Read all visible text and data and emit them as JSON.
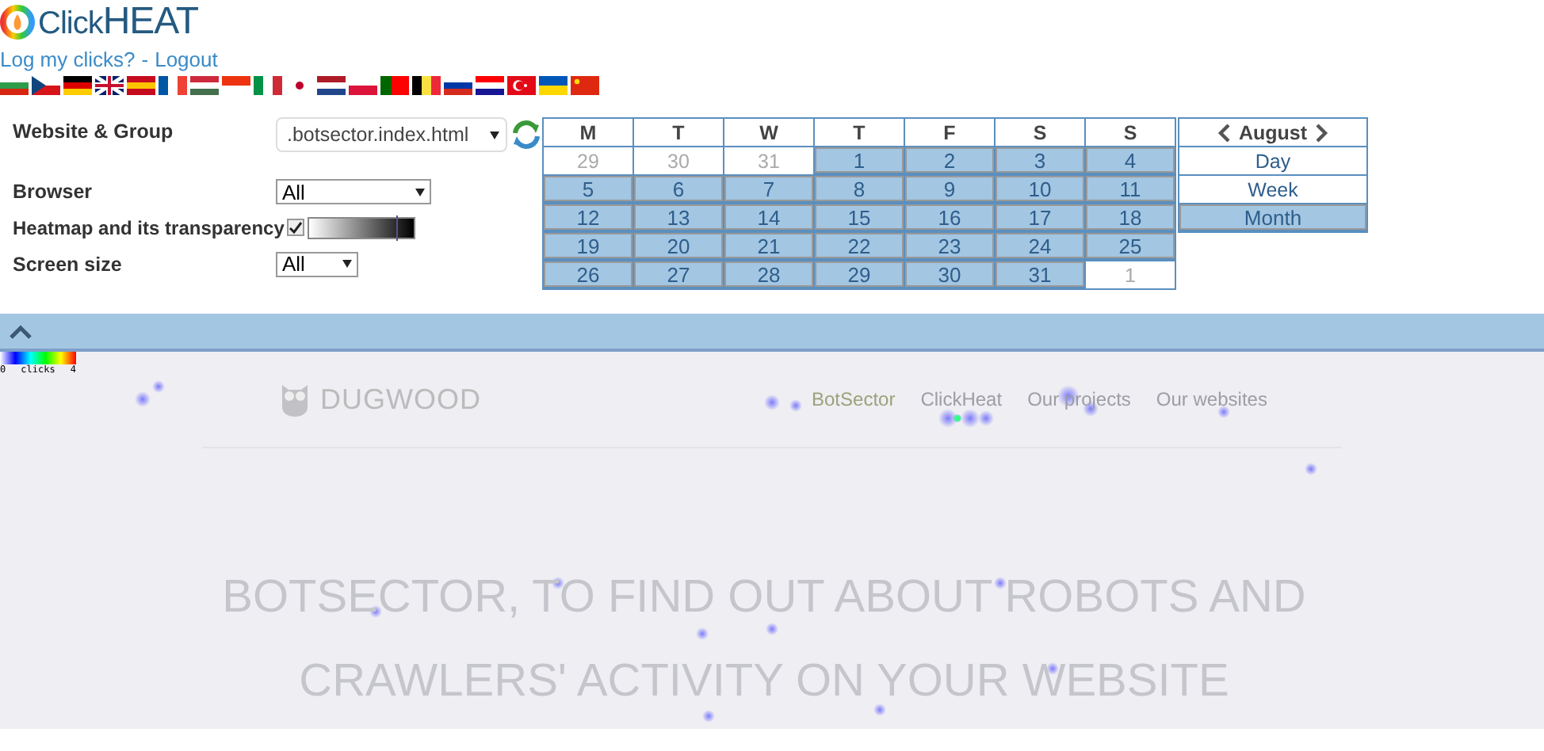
{
  "header": {
    "logo_light": "Click",
    "logo_bold": "HEAT",
    "links": [
      "Log my clicks?",
      "Logout"
    ],
    "separator": "-"
  },
  "form": [
    {
      "kind": "select-refresh",
      "label": "Website & Group",
      "value": ".botsector.index.html"
    },
    {
      "kind": "select",
      "label": "Browser",
      "value": "All"
    },
    {
      "kind": "transparency",
      "label": "Heatmap and its transparency",
      "checked": true,
      "level": 0.82
    },
    {
      "kind": "select-small",
      "label": "Screen size",
      "value": "All"
    }
  ],
  "calendar": {
    "weekdays": [
      "M",
      "T",
      "W",
      "T",
      "F",
      "S",
      "S"
    ],
    "weeks": [
      [
        {
          "day": "29",
          "selected": false
        },
        {
          "day": "30",
          "selected": false
        },
        {
          "day": "31",
          "selected": false
        },
        {
          "day": "1",
          "selected": true
        },
        {
          "day": "2",
          "selected": true
        },
        {
          "day": "3",
          "selected": true
        },
        {
          "day": "4",
          "selected": true
        }
      ],
      [
        {
          "day": "5",
          "selected": true
        },
        {
          "day": "6",
          "selected": true
        },
        {
          "day": "7",
          "selected": true
        },
        {
          "day": "8",
          "selected": true
        },
        {
          "day": "9",
          "selected": true
        },
        {
          "day": "10",
          "selected": true
        },
        {
          "day": "11",
          "selected": true
        }
      ],
      [
        {
          "day": "12",
          "selected": true
        },
        {
          "day": "13",
          "selected": true
        },
        {
          "day": "14",
          "selected": true
        },
        {
          "day": "15",
          "selected": true
        },
        {
          "day": "16",
          "selected": true
        },
        {
          "day": "17",
          "selected": true
        },
        {
          "day": "18",
          "selected": true
        }
      ],
      [
        {
          "day": "19",
          "selected": true
        },
        {
          "day": "20",
          "selected": true
        },
        {
          "day": "21",
          "selected": true
        },
        {
          "day": "22",
          "selected": true
        },
        {
          "day": "23",
          "selected": true
        },
        {
          "day": "24",
          "selected": true
        },
        {
          "day": "25",
          "selected": true
        }
      ],
      [
        {
          "day": "26",
          "selected": true
        },
        {
          "day": "27",
          "selected": true
        },
        {
          "day": "28",
          "selected": true
        },
        {
          "day": "29",
          "selected": true
        },
        {
          "day": "30",
          "selected": true
        },
        {
          "day": "31",
          "selected": true
        },
        {
          "day": "1",
          "selected": false
        }
      ]
    ],
    "month": "August",
    "views": [
      {
        "label": "Day",
        "selected": false
      },
      {
        "label": "Week",
        "selected": false
      },
      {
        "label": "Month",
        "selected": true
      }
    ]
  },
  "preview": {
    "legend": {
      "min": "0",
      "label": "clicks",
      "max": "4"
    },
    "site_logo": "DUGWOOD",
    "nav": [
      {
        "label": "BotSector",
        "selected": true
      },
      {
        "label": "ClickHeat",
        "selected": false
      },
      {
        "label": "Our projects",
        "selected": false
      },
      {
        "label": "Our websites",
        "selected": false
      }
    ],
    "headline": [
      "BOTSECTOR, TO FIND OUT ABOUT ROBOTS AND",
      "CRAWLERS' ACTIVITY ON YOUR WEBSITE"
    ]
  }
}
